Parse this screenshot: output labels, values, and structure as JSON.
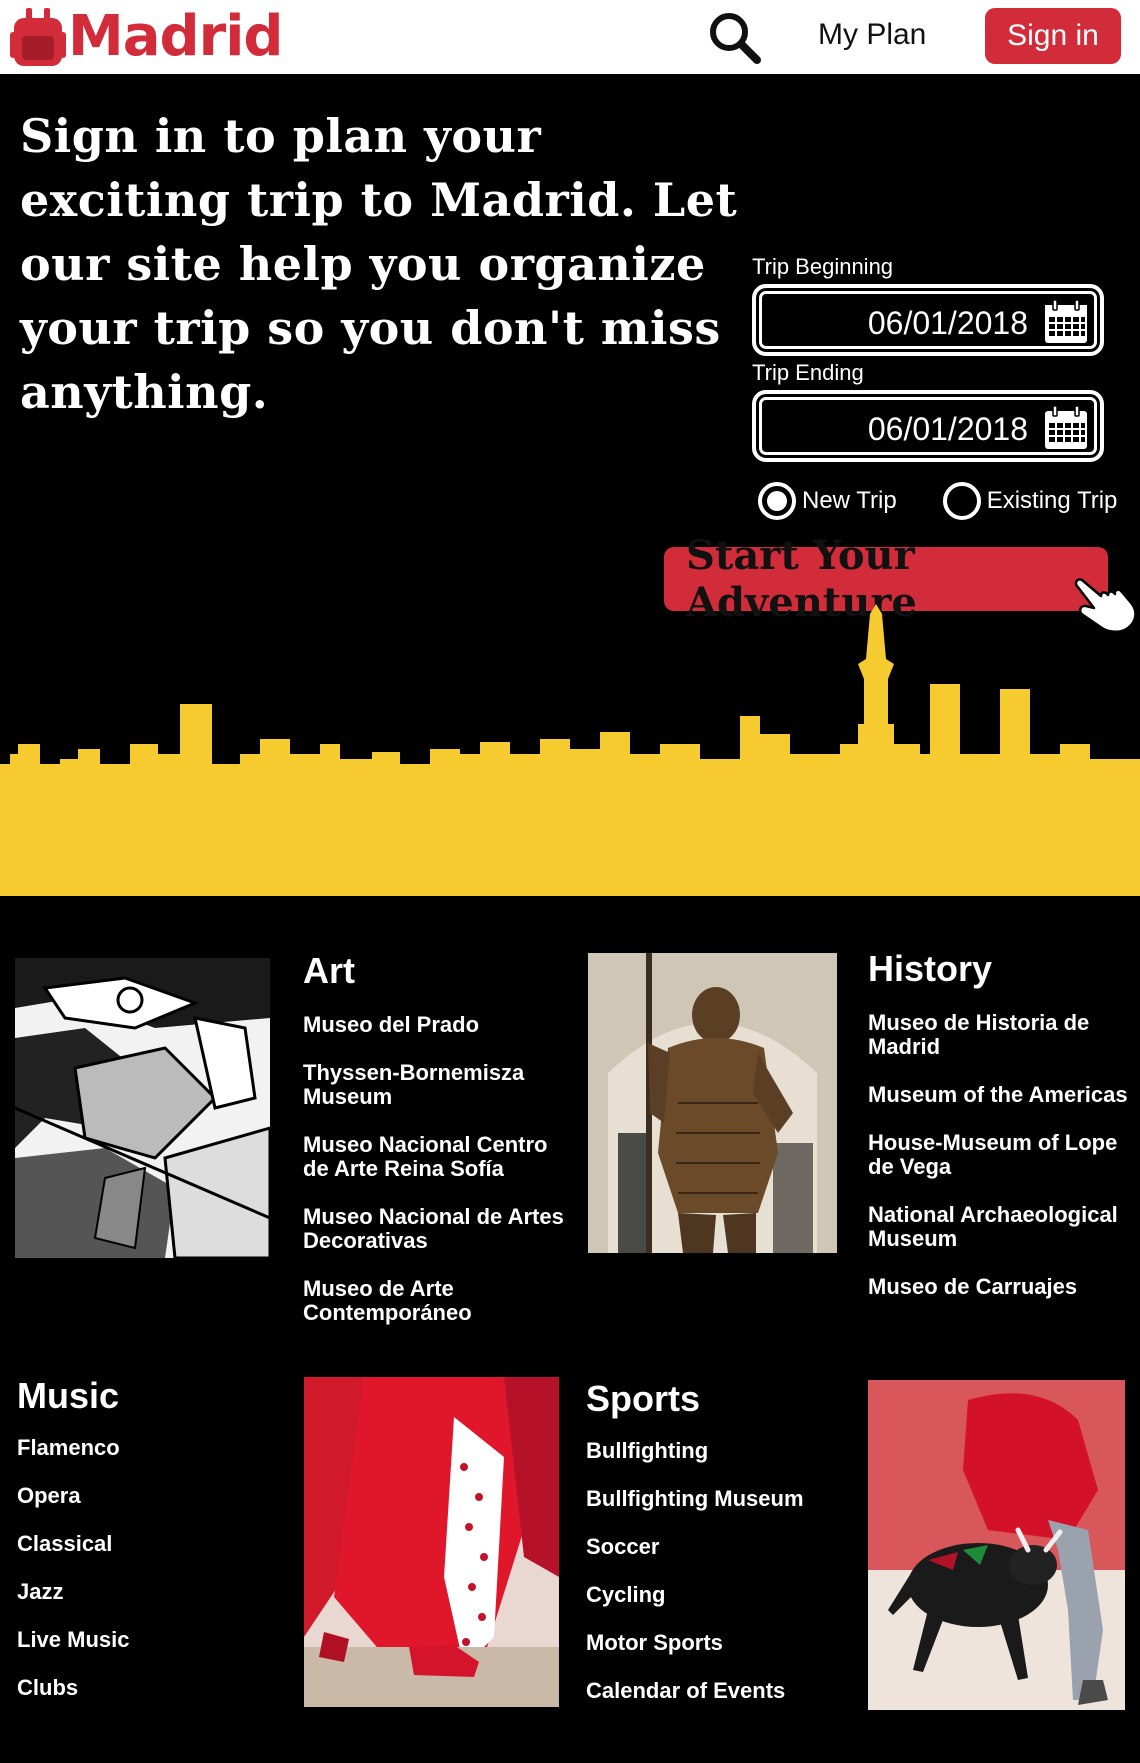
{
  "header": {
    "logo_text": "Madrid",
    "my_plan_label": "My Plan",
    "sign_in_label": "Sign in"
  },
  "hero": {
    "headline": "Sign in to plan your exciting trip to Madrid.  Let our site help you organize your trip so you don't miss anything.",
    "trip_beginning_label": "Trip Beginning",
    "trip_beginning_value": "06/01/2018",
    "trip_ending_label": "Trip Ending",
    "trip_ending_value": "06/01/2018",
    "radio_new_label": "New Trip",
    "radio_existing_label": "Existing Trip",
    "radio_selected": "New Trip",
    "cta_label": "Start Your Adventure"
  },
  "categories": {
    "art": {
      "heading": "Art",
      "items": [
        "Museo del Prado",
        "Thyssen-Bornemisza Museum",
        "Museo Nacional Centro de Arte Reina Sofía",
        "Museo Nacional de Artes Decorativas",
        "Museo de Arte Contemporáneo"
      ]
    },
    "history": {
      "heading": "History",
      "items": [
        "Museo de Historia de Madrid",
        "Museum of the Americas",
        "House-Museum of Lope de Vega",
        "National Archaeological Museum",
        "Museo de Carruajes"
      ]
    },
    "music": {
      "heading": "Music",
      "items": [
        "Flamenco",
        "Opera",
        "Classical",
        "Jazz",
        "Live Music",
        "Clubs"
      ]
    },
    "sports": {
      "heading": "Sports",
      "items": [
        "Bullfighting",
        "Bullfighting Museum",
        "Soccer",
        "Cycling",
        "Motor Sports",
        "Calendar of Events"
      ]
    }
  },
  "colors": {
    "brand_red": "#d22b3a",
    "skyline_yellow": "#f6cb2f",
    "background": "#000000"
  },
  "icons": [
    "backpack-icon",
    "search-icon",
    "calendar-icon",
    "pointer-hand-icon"
  ]
}
